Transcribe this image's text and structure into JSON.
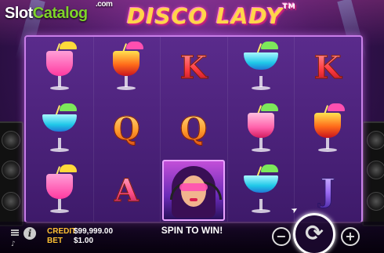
{
  "branding": {
    "site_logo_part1": "Slot",
    "site_logo_part2": "Catalog",
    "site_logo_suffix": ".com",
    "game_title": "DISCO LADY",
    "trademark": "TM"
  },
  "reels": [
    [
      "pink-cocktail",
      "blue-cocktail",
      "pink-cocktail"
    ],
    [
      "orange-cocktail",
      "Q",
      "A"
    ],
    [
      "K",
      "Q",
      "disco-lady"
    ],
    [
      "blue-cocktail",
      "redpink-cocktail",
      "blue-cocktail"
    ],
    [
      "K",
      "orange-cocktail",
      "J"
    ]
  ],
  "symbols": {
    "K": "K",
    "Q": "Q",
    "A": "A",
    "J": "J"
  },
  "panel": {
    "credit_label": "CREDIT",
    "credit_value": "$99,999.00",
    "bet_label": "BET",
    "bet_value": "$1.00",
    "message": "SPIN TO WIN!",
    "minus_label": "−",
    "plus_label": "+",
    "spin_label": "⟳",
    "info_label": "i"
  },
  "icons": {
    "menu": "menu-icon",
    "info": "info-icon",
    "sound": "sound-icon",
    "spin": "spin-icon",
    "autoplay": "autoplay-icon"
  },
  "colors": {
    "frame": "#c87de8",
    "label": "#ffc233",
    "title": "#ffd54a"
  }
}
